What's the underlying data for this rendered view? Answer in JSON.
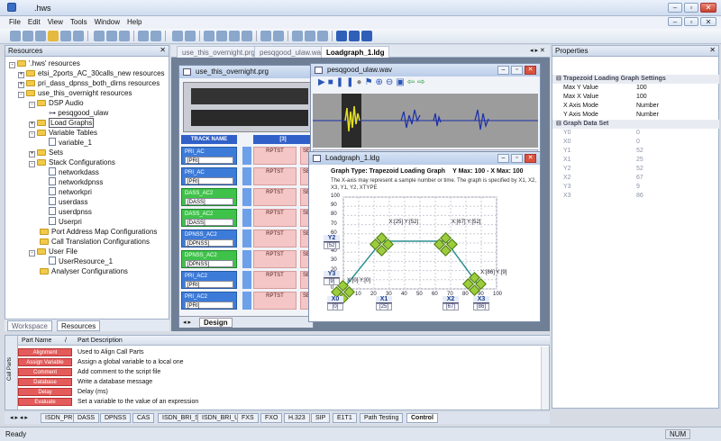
{
  "app": {
    "title": ".hws",
    "menu": [
      "File",
      "Edit",
      "View",
      "Tools",
      "Window",
      "Help"
    ]
  },
  "resources": {
    "header": "Resources",
    "root": "'.hws' resources",
    "items": [
      "etsi_2ports_AC_30calls_new resources",
      "pri_dass_dpnss_both_dirns resources",
      "use_this_overnight resources",
      "DSP Audio",
      "pesqgood_ulaw",
      "Load Graphs",
      "Variable Tables",
      "variable_1",
      "Sets",
      "Stack Configurations",
      "networkdass",
      "networkdpnss",
      "networkpri",
      "userdass",
      "userdpnss",
      "Userpri",
      "Port Address Map Configurations",
      "Call Translation Configurations",
      "User File",
      "UserResource_1",
      "Analyser Configurations"
    ],
    "tabs": [
      "Workspace",
      "Resources"
    ]
  },
  "doc_tabs": [
    "use_this_overnight.prg",
    "pesqgood_ulaw.wav",
    "Loadgraph_1.ldg"
  ],
  "prg": {
    "title": "use_this_overnight.prg",
    "track_header": "TRACK NAME",
    "col": "[3]",
    "design_tab": "Design",
    "tracks": [
      {
        "name": "PRI_AC",
        "val": "[PRI]",
        "color": "blue"
      },
      {
        "name": "PRI_AC",
        "val": "[PRI]",
        "color": "blue"
      },
      {
        "name": "DASS_AC2",
        "val": "[DASS]",
        "color": "green"
      },
      {
        "name": "DASS_AC2",
        "val": "[DASS]",
        "color": "green"
      },
      {
        "name": "DPNSS_AC2",
        "val": "[DPNSS]",
        "color": "blue"
      },
      {
        "name": "DPNSS_AC2",
        "val": "[DPNSS]",
        "color": "green"
      },
      {
        "name": "PRI_AC2",
        "val": "[PRI]",
        "color": "blue"
      },
      {
        "name": "PRI_AC2",
        "val": "[PRI]",
        "color": "blue"
      }
    ],
    "rp": "RPTST",
    "rp2": "SEQ"
  },
  "wav": {
    "title": "pesqgood_ulaw.wav"
  },
  "ldg": {
    "title": "Loadgraph_1.ldg",
    "graph_type_label": "Graph Type:",
    "graph_type": "Trapezoid Loading Graph",
    "ymax_label": "Y Max: 100 - X Max: 100",
    "desc": "The X-axis may represent a sample number or time. The graph is specified by X1, X2, X3, Y1, Y2, XTYPE",
    "y_ticks": [
      "100",
      "90",
      "80",
      "70",
      "60",
      "50",
      "40",
      "30",
      "20",
      "10",
      "0"
    ],
    "x_ticks": [
      "0",
      "10",
      "20",
      "30",
      "40",
      "50",
      "60",
      "70",
      "80",
      "90",
      "100"
    ],
    "points": [
      {
        "label": "X:[0] Y:[0]"
      },
      {
        "label": "X:[25] Y:[52]"
      },
      {
        "label": "X:[67] Y:[52]"
      },
      {
        "label": "X:[86] Y:[9]"
      }
    ],
    "badges": [
      {
        "n": "Y2",
        "v": "[52]"
      },
      {
        "n": "Y3",
        "v": "[9]"
      },
      {
        "n": "X0",
        "v": "[0]"
      },
      {
        "n": "X1",
        "v": "[25]"
      },
      {
        "n": "X2",
        "v": "[67]"
      },
      {
        "n": "X3",
        "v": "[86]"
      }
    ]
  },
  "properties": {
    "header": "Properties",
    "sec1": "Trapezoid Loading Graph Settings",
    "settings": [
      {
        "k": "Max Y Value",
        "v": "100"
      },
      {
        "k": "Max X Value",
        "v": "100"
      },
      {
        "k": "X Axis Mode",
        "v": "Number"
      },
      {
        "k": "Y Axis Mode",
        "v": "Number"
      }
    ],
    "sec2": "Graph Data Set",
    "data": [
      {
        "k": "Y0",
        "v": "0"
      },
      {
        "k": "X0",
        "v": "0"
      },
      {
        "k": "Y1",
        "v": "52"
      },
      {
        "k": "X1",
        "v": "25"
      },
      {
        "k": "Y2",
        "v": "52"
      },
      {
        "k": "X2",
        "v": "67"
      },
      {
        "k": "Y3",
        "v": "9"
      },
      {
        "k": "X3",
        "v": "86"
      }
    ]
  },
  "parts": {
    "col1": "Part Name",
    "col2": "Part Description",
    "side": "Call Parts",
    "rows": [
      {
        "n": "Alignment",
        "d": "Used to Align Call Parts"
      },
      {
        "n": "Assign Variable",
        "d": "Assign a global variable to a local one"
      },
      {
        "n": "Comment",
        "d": "Add comment to the script file"
      },
      {
        "n": "Database",
        "d": "Write a database message"
      },
      {
        "n": "Delay",
        "d": "Delay (ms)"
      },
      {
        "n": "Evaluate",
        "d": "Set a variable to the value of an expression"
      }
    ],
    "tabs": [
      "ISDN_PRI",
      "DASS",
      "DPNSS",
      "CAS",
      "ISDN_BRI_S",
      "ISDN_BRI_U",
      "FXS",
      "FXO",
      "H.323",
      "SIP",
      "E1T1",
      "Path Testing",
      "Control"
    ]
  },
  "status": {
    "left": "Ready",
    "num": "NUM"
  },
  "colors": {
    "accent": "#3060c8",
    "part": "#e35b5b",
    "point": "#9ccc3c"
  }
}
